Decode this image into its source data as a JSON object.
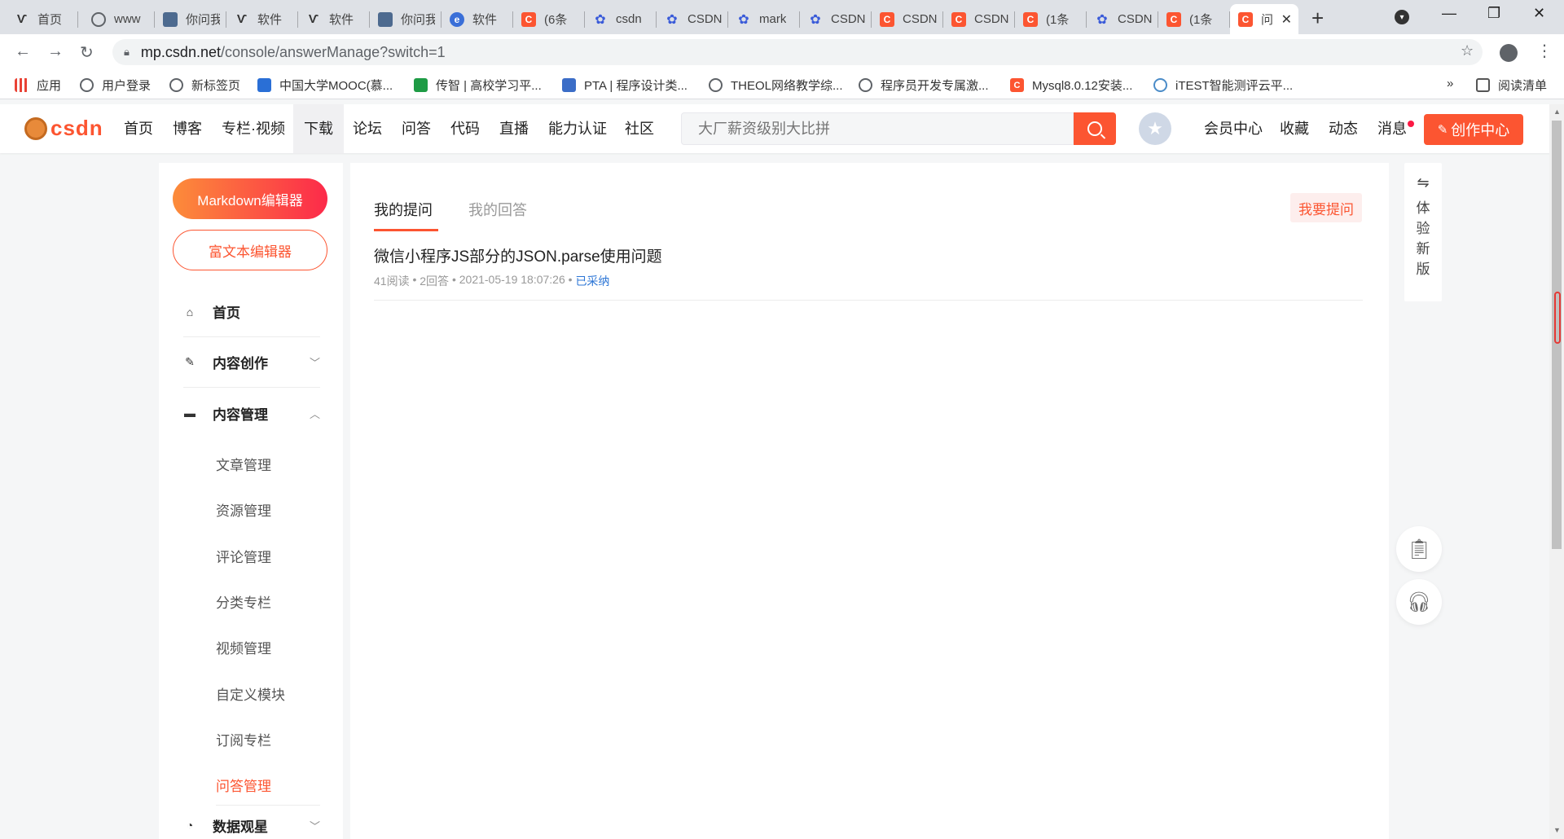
{
  "browser": {
    "tabs": [
      {
        "favicon": "paw-icon",
        "fav_style": "f-n",
        "fav_glyph": "Ѵ",
        "label": "首页"
      },
      {
        "favicon": "globe-icon",
        "fav_style": "f-globe",
        "fav_glyph": "",
        "label": "www"
      },
      {
        "favicon": "image-icon",
        "fav_style": "f-img",
        "fav_glyph": "",
        "label": "你问我"
      },
      {
        "favicon": "paw-icon",
        "fav_style": "f-n",
        "fav_glyph": "Ѵ",
        "label": "软件"
      },
      {
        "favicon": "paw-icon",
        "fav_style": "f-n",
        "fav_glyph": "Ѵ",
        "label": "软件"
      },
      {
        "favicon": "image-icon",
        "fav_style": "f-img",
        "fav_glyph": "",
        "label": "你问我"
      },
      {
        "favicon": "e-icon",
        "fav_style": "f-e",
        "fav_glyph": "e",
        "label": "软件"
      },
      {
        "favicon": "csdn-icon",
        "fav_style": "f-c",
        "fav_glyph": "C",
        "label": "(6条"
      },
      {
        "favicon": "paw-icon",
        "fav_style": "f-paw",
        "fav_glyph": "✿",
        "label": "csdn"
      },
      {
        "favicon": "paw-icon",
        "fav_style": "f-paw",
        "fav_glyph": "✿",
        "label": "CSDN"
      },
      {
        "favicon": "paw-icon",
        "fav_style": "f-paw",
        "fav_glyph": "✿",
        "label": "mark"
      },
      {
        "favicon": "paw-icon",
        "fav_style": "f-paw",
        "fav_glyph": "✿",
        "label": "CSDN"
      },
      {
        "favicon": "csdn-icon",
        "fav_style": "f-c",
        "fav_glyph": "C",
        "label": "CSDN"
      },
      {
        "favicon": "csdn-icon",
        "fav_style": "f-c",
        "fav_glyph": "C",
        "label": "CSDN"
      },
      {
        "favicon": "csdn-icon",
        "fav_style": "f-c",
        "fav_glyph": "C",
        "label": "(1条"
      },
      {
        "favicon": "paw-icon",
        "fav_style": "f-paw",
        "fav_glyph": "✿",
        "label": "CSDN"
      },
      {
        "favicon": "csdn-icon",
        "fav_style": "f-c",
        "fav_glyph": "C",
        "label": "(1条"
      },
      {
        "favicon": "csdn-icon",
        "fav_style": "f-c",
        "fav_glyph": "C",
        "label": "问"
      }
    ],
    "url_host": "mp.csdn.net",
    "url_path": "/console/answerManage?switch=1",
    "bookmarks": [
      {
        "icon": "apps-icon",
        "style": "apps",
        "label": "应用"
      },
      {
        "icon": "globe-icon",
        "style": "g",
        "label": "用户登录"
      },
      {
        "icon": "globe-icon",
        "style": "g",
        "label": "新标签页"
      },
      {
        "icon": "mooc-icon",
        "style": "blue",
        "label": "中国大学MOOC(慕..."
      },
      {
        "icon": "graduation-cap-icon",
        "style": "green",
        "label": "传智 | 高校学习平..."
      },
      {
        "icon": "pta-icon",
        "style": "pta",
        "label": "PTA | 程序设计类..."
      },
      {
        "icon": "globe-icon",
        "style": "g",
        "label": "THEOL网络教学综..."
      },
      {
        "icon": "globe-icon",
        "style": "g",
        "label": "程序员开发专属激..."
      },
      {
        "icon": "csdn-icon",
        "style": "c",
        "label": "Mysql8.0.12安装..."
      },
      {
        "icon": "itest-icon",
        "style": "itest",
        "label": "iTEST智能测评云平..."
      }
    ],
    "overflow": "»",
    "reading_list": "阅读清单"
  },
  "header": {
    "logo": "csdn",
    "nav": [
      "首页",
      "博客",
      "专栏·视频",
      "下载",
      "论坛",
      "问答",
      "代码",
      "直播",
      "能力认证",
      "社区"
    ],
    "search_placeholder": "大厂薪资级别大比拼",
    "links": {
      "vip": "会员中心",
      "favorites": "收藏",
      "dynamic": "动态",
      "messages": "消息"
    },
    "create_label": "创作中心"
  },
  "sidebar": {
    "markdown_btn": "Markdown编辑器",
    "richtext_btn": "富文本编辑器",
    "home": "首页",
    "content_creation": "内容创作",
    "content_manage": "内容管理",
    "submenu": [
      "文章管理",
      "资源管理",
      "评论管理",
      "分类专栏",
      "视频管理",
      "自定义模块",
      "订阅专栏",
      "问答管理"
    ],
    "data_observe": "数据观星"
  },
  "main": {
    "tab_my_questions": "我的提问",
    "tab_my_answers": "我的回答",
    "ask_btn": "我要提问",
    "question": {
      "title": "微信小程序JS部分的JSON.parse使用问题",
      "reads": "41阅读",
      "answers": "2回答",
      "time": "2021-05-19 18:07:26",
      "status": "已采纳"
    }
  },
  "side_panel": {
    "chars": [
      "体",
      "验",
      "新",
      "版"
    ]
  }
}
